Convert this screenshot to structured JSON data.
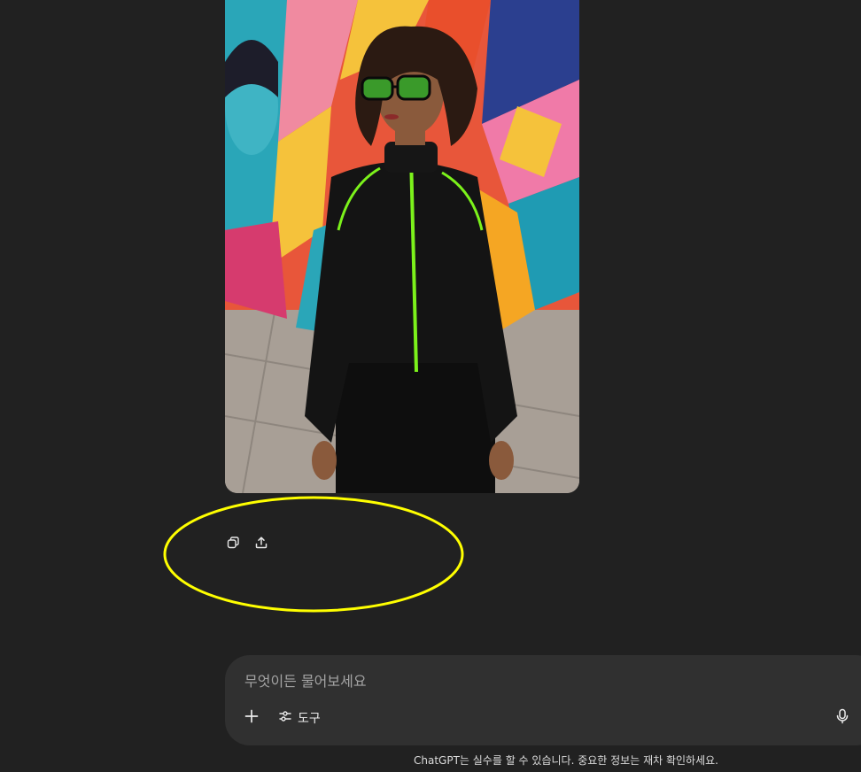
{
  "image": {
    "alt": "",
    "colors": {
      "jacket": "#111111",
      "accent_green": "#7cf21b",
      "skin": "#8a5a3c",
      "hair": "#2b1a12"
    }
  },
  "message_actions": [
    {
      "icon": "copy-icon"
    },
    {
      "icon": "share-icon"
    }
  ],
  "highlight": {
    "color": "#ffff00"
  },
  "composer": {
    "placeholder": "무엇이든 물어보세요",
    "tools_label": "도구",
    "icons": [
      "plus-icon",
      "tools-sliders-icon",
      "microphone-icon"
    ]
  },
  "disclaimer": "ChatGPT는 실수를 할 수 있습니다. 중요한 정보는 재차 확인하세요."
}
